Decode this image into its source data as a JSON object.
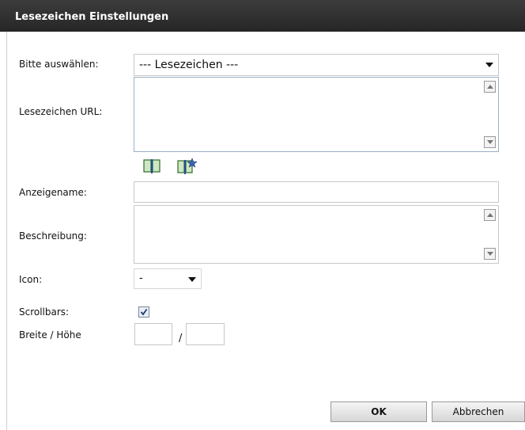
{
  "dialog": {
    "title": "Lesezeichen Einstellungen"
  },
  "form": {
    "select_label": "Bitte auswählen:",
    "select_value": "--- Lesezeichen ---",
    "url_label": "Lesezeichen URL:",
    "url_value": "",
    "display_name_label": "Anzeigename:",
    "display_name_value": "",
    "description_label": "Beschreibung:",
    "description_value": "",
    "icon_label": "Icon:",
    "icon_value": "-",
    "scrollbars_label": "Scrollbars:",
    "scrollbars_checked": true,
    "size_label": "Breite / Höhe",
    "size_separator": "/",
    "width_value": "",
    "height_value": ""
  },
  "buttons": {
    "ok": "OK",
    "cancel": "Abbrechen"
  },
  "icons": {
    "bookmark_browse": "open-book-icon",
    "bookmark_add": "book-star-icon"
  },
  "colors": {
    "titlebar": "#2f2f2f",
    "textarea_border": "#9ab0c8"
  }
}
